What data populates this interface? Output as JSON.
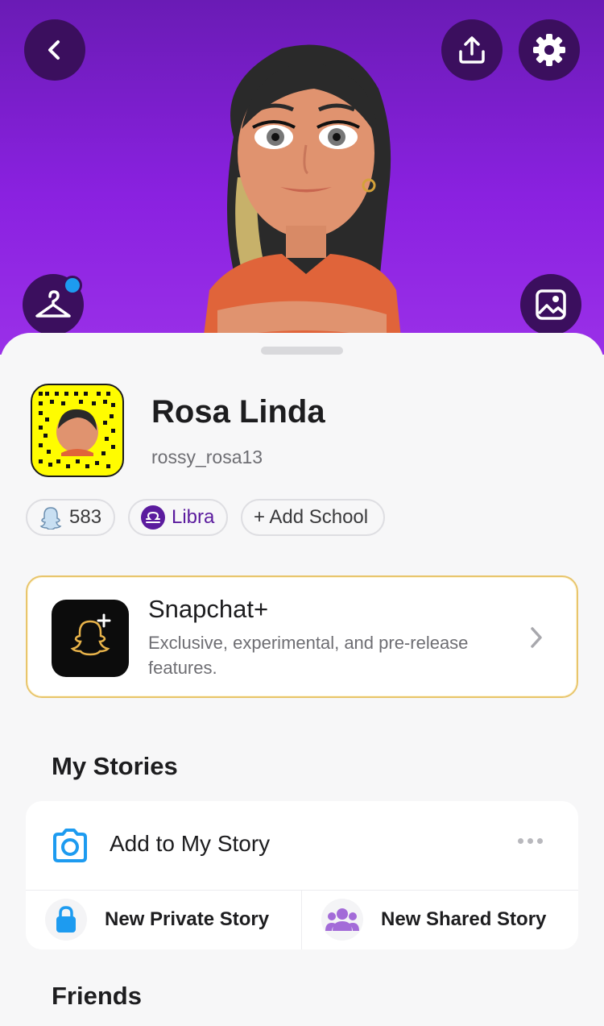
{
  "profile": {
    "name": "Rosa Linda",
    "username": "rossy_rosa13",
    "score": "583",
    "zodiac": "Libra",
    "add_school": "+ Add School"
  },
  "snapchat_plus": {
    "title": "Snapchat+",
    "description": "Exclusive, experimental, and pre-release features."
  },
  "my_stories": {
    "title": "My Stories",
    "add_story": "Add to My Story",
    "new_private": "New Private Story",
    "new_shared": "New Shared Story"
  },
  "friends": {
    "title": "Friends"
  },
  "colors": {
    "hero_purple": "#8a21e0",
    "button_dark_purple": "#3b0f5e",
    "snapcode_yellow": "#fffc00",
    "notification_blue": "#1d9bf0",
    "libra_purple": "#5b1b9e",
    "plus_gold": "#e8c56c",
    "camera_blue": "#1d9bf0",
    "lock_blue": "#1d9bf0",
    "group_purple": "#a36bd8"
  },
  "icons": {
    "back": "chevron-left-icon",
    "share": "upload-icon",
    "settings": "gear-icon",
    "wardrobe": "hanger-icon",
    "background": "image-icon",
    "score": "ghost-icon",
    "zodiac": "libra-icon",
    "plus": "snapchat-plus-icon",
    "camera": "camera-icon",
    "more": "more-dots-icon",
    "lock": "lock-icon",
    "group": "group-icon",
    "chevron": "chevron-right-icon"
  }
}
